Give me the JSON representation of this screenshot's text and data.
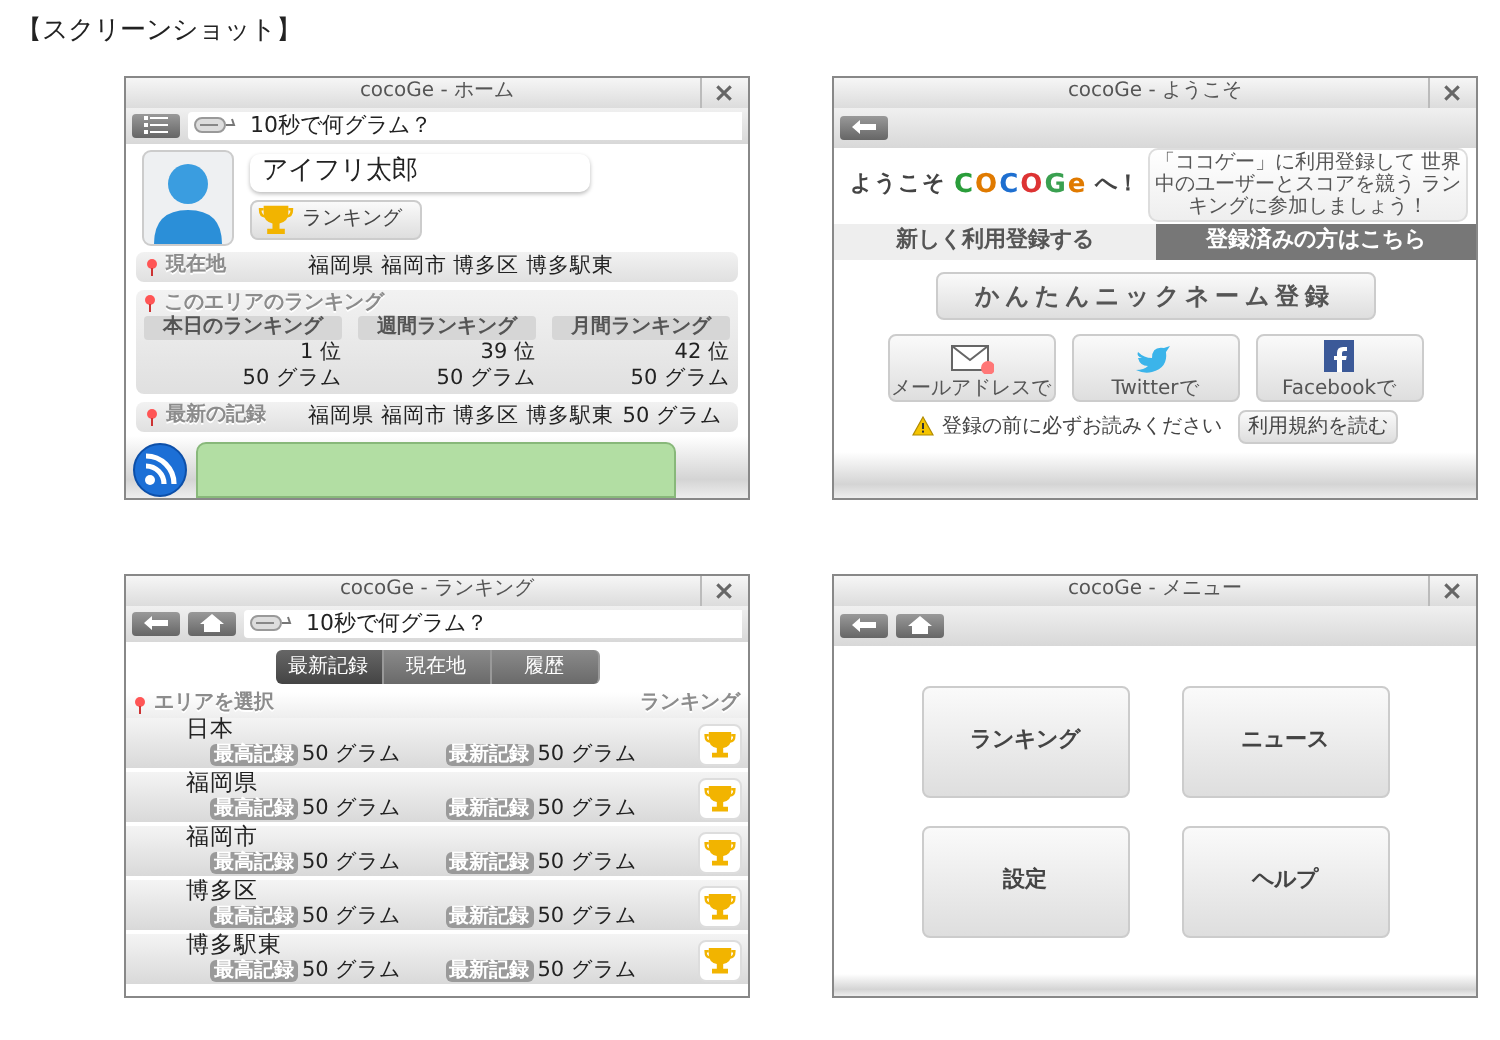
{
  "page_heading": "【スクリーンショット】",
  "screens": [
    {
      "kind": "home",
      "title": "cocoGe - ホーム",
      "toolbar_buttons": [
        {
          "kind": "menu"
        }
      ],
      "quiz": "10秒で何グラム？",
      "profile": {
        "name": "アイフリ太郎",
        "ranking_button": "ランキング"
      },
      "location": {
        "label": "現在地",
        "value": "福岡県 福岡市 博多区 博多駅東"
      },
      "area_ranking": {
        "label": "このエリアのランキング",
        "columns": [
          {
            "heading": "本日のランキング",
            "rank": "1 位",
            "grams": "50 グラム"
          },
          {
            "heading": "週間ランキング",
            "rank": "39 位",
            "grams": "50 グラム"
          },
          {
            "heading": "月間ランキング",
            "rank": "42 位",
            "grams": "50 グラム"
          }
        ]
      },
      "latest_record": {
        "label": "最新の記録",
        "place": "福岡県 福岡市 博多区 博多駅東",
        "grams": "50 グラム"
      }
    },
    {
      "kind": "welcome",
      "title": "cocoGe - ようこそ",
      "toolbar_buttons": [
        {
          "kind": "back"
        }
      ],
      "welcome_before": "ようこそ",
      "logo": "COCOGe",
      "welcome_after": "へ！",
      "info": "「ココゲー」に利用登録して 世界中のユーザーとスコアを競う ランキングに参加しましょう！",
      "tabs": [
        {
          "label": "新しく利用登録する",
          "selected": true
        },
        {
          "label": "登録済みの方はこちら",
          "selected": false
        }
      ],
      "main_button": "かんたんニックネーム登録",
      "signup_buttons": [
        {
          "kind": "mail",
          "label": "メールアドレスで"
        },
        {
          "kind": "twitter",
          "label": "Twitterで"
        },
        {
          "kind": "facebook",
          "label": "Facebookで"
        }
      ],
      "notice": "登録の前に必ずお読みください",
      "terms_button": "利用規約を読む"
    },
    {
      "kind": "ranking",
      "title": "cocoGe - ランキング",
      "toolbar_buttons": [
        {
          "kind": "back"
        },
        {
          "kind": "home"
        }
      ],
      "quiz": "10秒で何グラム？",
      "segments": [
        {
          "label": "最新記録",
          "selected": true
        },
        {
          "label": "現在地",
          "selected": false
        },
        {
          "label": "履歴",
          "selected": false
        }
      ],
      "list_header": {
        "left": "エリアを選択",
        "right": "ランキング"
      },
      "rows": [
        {
          "area": "日本",
          "best_label": "最高記録",
          "best": "50 グラム",
          "latest_label": "最新記録",
          "latest": "50 グラム"
        },
        {
          "area": "福岡県",
          "best_label": "最高記録",
          "best": "50 グラム",
          "latest_label": "最新記録",
          "latest": "50 グラム"
        },
        {
          "area": "福岡市",
          "best_label": "最高記録",
          "best": "50 グラム",
          "latest_label": "最新記録",
          "latest": "50 グラム"
        },
        {
          "area": "博多区",
          "best_label": "最高記録",
          "best": "50 グラム",
          "latest_label": "最新記録",
          "latest": "50 グラム"
        },
        {
          "area": "博多駅東",
          "best_label": "最高記録",
          "best": "50 グラム",
          "latest_label": "最新記録",
          "latest": "50 グラム"
        }
      ]
    },
    {
      "kind": "menu",
      "title": "cocoGe - メニュー",
      "toolbar_buttons": [
        {
          "kind": "back"
        },
        {
          "kind": "home"
        }
      ],
      "menu_buttons": [
        "ランキング",
        "ニュース",
        "設定",
        "ヘルプ"
      ]
    }
  ]
}
